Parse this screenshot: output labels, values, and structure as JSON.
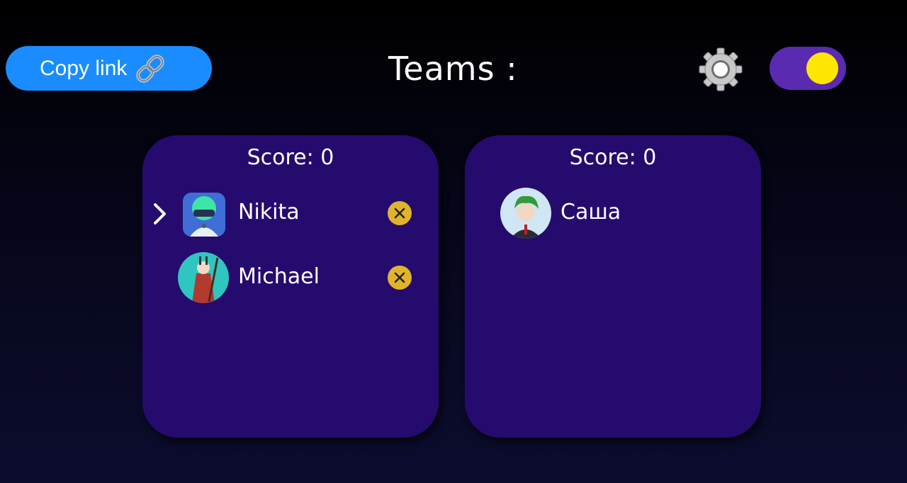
{
  "header": {
    "copy_link_label": "Copy link",
    "title": "Teams :"
  },
  "icons": {
    "link": "link-icon",
    "settings": "gear-icon",
    "theme_toggle": "toggle-switch",
    "selected_marker": "chevron-right-icon",
    "remove": "close-circle-icon"
  },
  "colors": {
    "copy_button": "#1a8cff",
    "team_card": "#260b6e",
    "toggle_track": "#5a2ab0",
    "toggle_knob": "#ffe600",
    "remove_button": "#e0b42a"
  },
  "toggle": {
    "on": true
  },
  "teams": [
    {
      "score_label": "Score: 0",
      "players": [
        {
          "name": "Nikita",
          "selected": true,
          "removable": true,
          "avatar": "green-hair-robot-avatar"
        },
        {
          "name": "Michael",
          "selected": false,
          "removable": true,
          "avatar": "samurai-avatar"
        }
      ]
    },
    {
      "score_label": "Score: 0",
      "players": [
        {
          "name": "Саша",
          "selected": false,
          "removable": false,
          "avatar": "green-hair-anime-avatar"
        }
      ]
    }
  ]
}
